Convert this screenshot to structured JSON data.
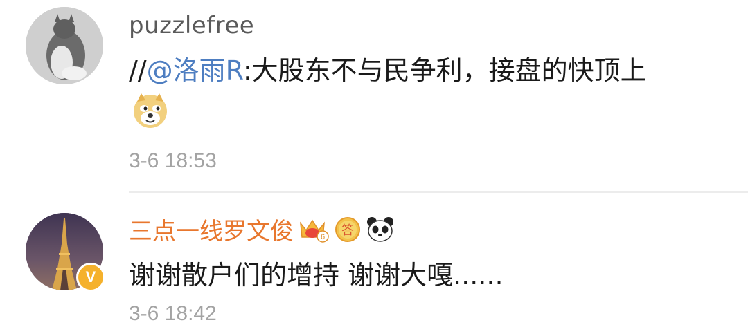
{
  "comments": [
    {
      "username": "puzzlefree",
      "text_prefix": "//",
      "mention": "@洛雨R",
      "text_body": ":大股东不与民争利，接盘的快顶上",
      "emoji": "doge-emoji",
      "time": "3-6 18:53",
      "avatar": "cat-photo"
    },
    {
      "username": "三点一线罗文俊",
      "badges": [
        "crown-level-6-icon",
        "answer-badge-icon",
        "panda-icon"
      ],
      "badge_level": "6",
      "badge_answer_label": "答",
      "verified_label": "V",
      "text": "谢谢散户们的增持 谢谢大嘎......",
      "time": "3-6 18:42",
      "avatar": "eiffel-tower-photo"
    }
  ],
  "colors": {
    "username_default": "#5a5a5a",
    "username_vip": "#e8772e",
    "mention": "#4e7ec1",
    "time": "#a3a3a3",
    "verified": "#f5b12c"
  }
}
